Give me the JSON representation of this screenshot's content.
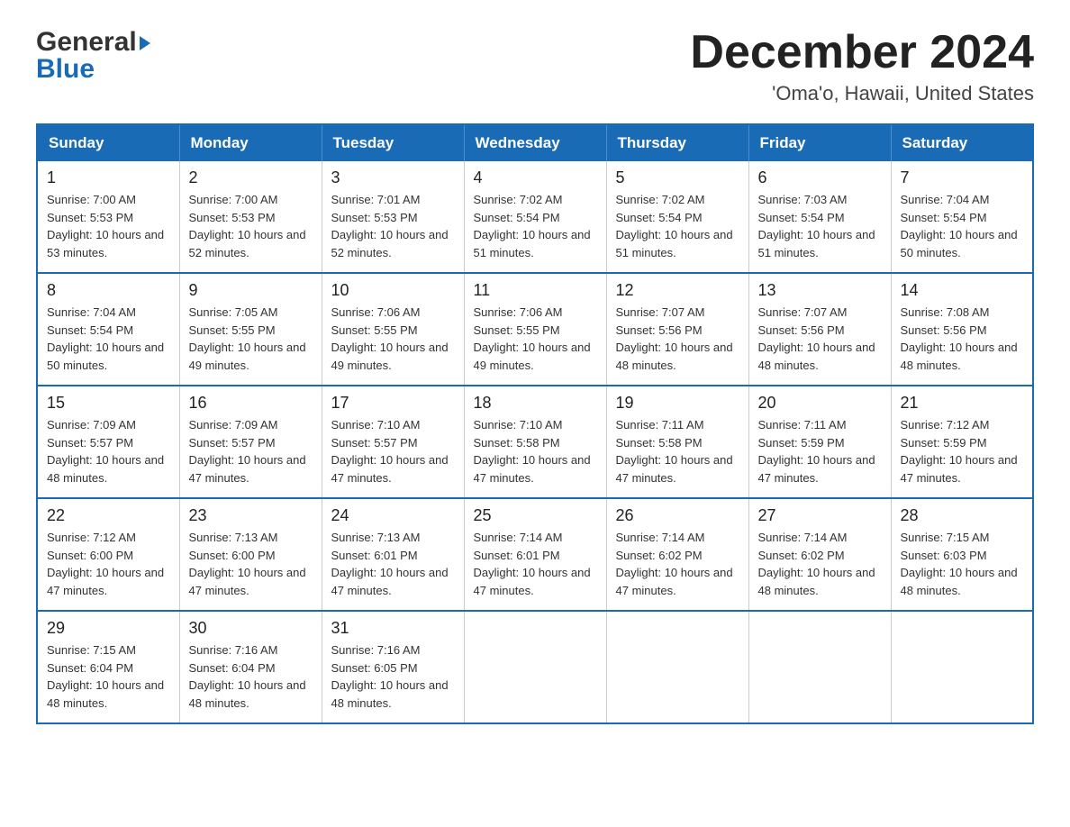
{
  "logo": {
    "general": "General",
    "blue": "Blue",
    "triangle": "▶"
  },
  "header": {
    "month_year": "December 2024",
    "location": "'Oma'o, Hawaii, United States"
  },
  "days_of_week": [
    "Sunday",
    "Monday",
    "Tuesday",
    "Wednesday",
    "Thursday",
    "Friday",
    "Saturday"
  ],
  "weeks": [
    [
      {
        "day": "1",
        "sunrise": "7:00 AM",
        "sunset": "5:53 PM",
        "daylight": "10 hours and 53 minutes."
      },
      {
        "day": "2",
        "sunrise": "7:00 AM",
        "sunset": "5:53 PM",
        "daylight": "10 hours and 52 minutes."
      },
      {
        "day": "3",
        "sunrise": "7:01 AM",
        "sunset": "5:53 PM",
        "daylight": "10 hours and 52 minutes."
      },
      {
        "day": "4",
        "sunrise": "7:02 AM",
        "sunset": "5:54 PM",
        "daylight": "10 hours and 51 minutes."
      },
      {
        "day": "5",
        "sunrise": "7:02 AM",
        "sunset": "5:54 PM",
        "daylight": "10 hours and 51 minutes."
      },
      {
        "day": "6",
        "sunrise": "7:03 AM",
        "sunset": "5:54 PM",
        "daylight": "10 hours and 51 minutes."
      },
      {
        "day": "7",
        "sunrise": "7:04 AM",
        "sunset": "5:54 PM",
        "daylight": "10 hours and 50 minutes."
      }
    ],
    [
      {
        "day": "8",
        "sunrise": "7:04 AM",
        "sunset": "5:54 PM",
        "daylight": "10 hours and 50 minutes."
      },
      {
        "day": "9",
        "sunrise": "7:05 AM",
        "sunset": "5:55 PM",
        "daylight": "10 hours and 49 minutes."
      },
      {
        "day": "10",
        "sunrise": "7:06 AM",
        "sunset": "5:55 PM",
        "daylight": "10 hours and 49 minutes."
      },
      {
        "day": "11",
        "sunrise": "7:06 AM",
        "sunset": "5:55 PM",
        "daylight": "10 hours and 49 minutes."
      },
      {
        "day": "12",
        "sunrise": "7:07 AM",
        "sunset": "5:56 PM",
        "daylight": "10 hours and 48 minutes."
      },
      {
        "day": "13",
        "sunrise": "7:07 AM",
        "sunset": "5:56 PM",
        "daylight": "10 hours and 48 minutes."
      },
      {
        "day": "14",
        "sunrise": "7:08 AM",
        "sunset": "5:56 PM",
        "daylight": "10 hours and 48 minutes."
      }
    ],
    [
      {
        "day": "15",
        "sunrise": "7:09 AM",
        "sunset": "5:57 PM",
        "daylight": "10 hours and 48 minutes."
      },
      {
        "day": "16",
        "sunrise": "7:09 AM",
        "sunset": "5:57 PM",
        "daylight": "10 hours and 47 minutes."
      },
      {
        "day": "17",
        "sunrise": "7:10 AM",
        "sunset": "5:57 PM",
        "daylight": "10 hours and 47 minutes."
      },
      {
        "day": "18",
        "sunrise": "7:10 AM",
        "sunset": "5:58 PM",
        "daylight": "10 hours and 47 minutes."
      },
      {
        "day": "19",
        "sunrise": "7:11 AM",
        "sunset": "5:58 PM",
        "daylight": "10 hours and 47 minutes."
      },
      {
        "day": "20",
        "sunrise": "7:11 AM",
        "sunset": "5:59 PM",
        "daylight": "10 hours and 47 minutes."
      },
      {
        "day": "21",
        "sunrise": "7:12 AM",
        "sunset": "5:59 PM",
        "daylight": "10 hours and 47 minutes."
      }
    ],
    [
      {
        "day": "22",
        "sunrise": "7:12 AM",
        "sunset": "6:00 PM",
        "daylight": "10 hours and 47 minutes."
      },
      {
        "day": "23",
        "sunrise": "7:13 AM",
        "sunset": "6:00 PM",
        "daylight": "10 hours and 47 minutes."
      },
      {
        "day": "24",
        "sunrise": "7:13 AM",
        "sunset": "6:01 PM",
        "daylight": "10 hours and 47 minutes."
      },
      {
        "day": "25",
        "sunrise": "7:14 AM",
        "sunset": "6:01 PM",
        "daylight": "10 hours and 47 minutes."
      },
      {
        "day": "26",
        "sunrise": "7:14 AM",
        "sunset": "6:02 PM",
        "daylight": "10 hours and 47 minutes."
      },
      {
        "day": "27",
        "sunrise": "7:14 AM",
        "sunset": "6:02 PM",
        "daylight": "10 hours and 48 minutes."
      },
      {
        "day": "28",
        "sunrise": "7:15 AM",
        "sunset": "6:03 PM",
        "daylight": "10 hours and 48 minutes."
      }
    ],
    [
      {
        "day": "29",
        "sunrise": "7:15 AM",
        "sunset": "6:04 PM",
        "daylight": "10 hours and 48 minutes."
      },
      {
        "day": "30",
        "sunrise": "7:16 AM",
        "sunset": "6:04 PM",
        "daylight": "10 hours and 48 minutes."
      },
      {
        "day": "31",
        "sunrise": "7:16 AM",
        "sunset": "6:05 PM",
        "daylight": "10 hours and 48 minutes."
      },
      null,
      null,
      null,
      null
    ]
  ]
}
